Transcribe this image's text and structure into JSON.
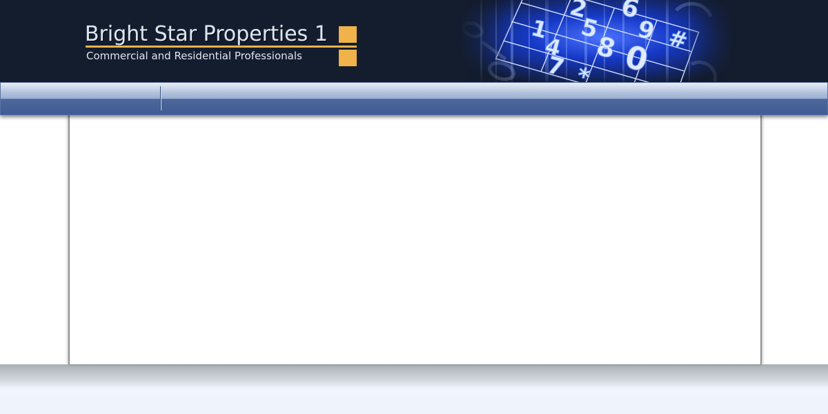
{
  "header": {
    "site_title": "Bright Star Properties 1",
    "tagline": "Commercial and Residential Professionals",
    "keypad_digits": [
      "1",
      "4",
      "7",
      "2",
      "5",
      "8",
      "*",
      "6",
      "9",
      "0",
      "#"
    ]
  },
  "navigation": {
    "items": []
  },
  "colors": {
    "header_background": "#141d2e",
    "accent": "#f0b24a",
    "navigation_blue": "#3f5c95",
    "footer": "#eef3fc"
  }
}
